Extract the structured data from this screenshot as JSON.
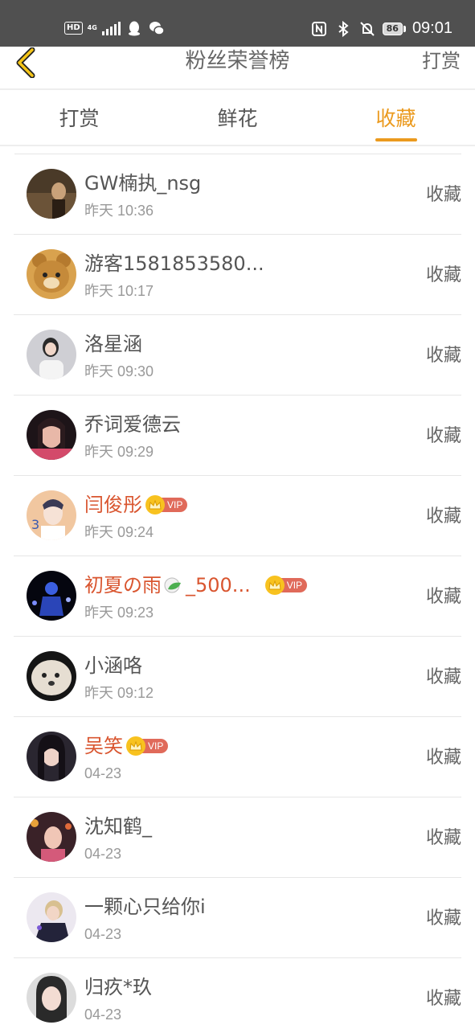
{
  "status_bar": {
    "hd": "HD",
    "network": "4G",
    "time": "09:01",
    "battery": "86"
  },
  "header": {
    "title": "粉丝荣誉榜",
    "action_label": "打赏"
  },
  "tabs": [
    {
      "label": "打赏",
      "active": false
    },
    {
      "label": "鲜花",
      "active": false
    },
    {
      "label": "收藏",
      "active": true
    }
  ],
  "colors": {
    "accent": "#eb9a1e",
    "vip_name": "#d9552f",
    "vip_tag": "#e06a5a",
    "crown": "#f8c21f"
  },
  "rows": [
    {
      "name": "GW楠执_nsg",
      "time": "昨天 10:36",
      "action": "收藏",
      "vip": false
    },
    {
      "name": "游客1581853580...",
      "time": "昨天 10:17",
      "action": "收藏",
      "vip": false
    },
    {
      "name": "洛星涵",
      "time": "昨天 09:30",
      "action": "收藏",
      "vip": false
    },
    {
      "name": "乔词爱德云",
      "time": "昨天 09:29",
      "action": "收藏",
      "vip": false
    },
    {
      "name": "闫俊彤",
      "time": "昨天 09:24",
      "action": "收藏",
      "vip": true,
      "vip_label": "VIP"
    },
    {
      "name_a": "初夏の雨",
      "name_b": "_500...",
      "time": "昨天 09:23",
      "action": "收藏",
      "vip": true,
      "vip_label": "VIP"
    },
    {
      "name": "小涵咯",
      "time": "昨天 09:12",
      "action": "收藏",
      "vip": false
    },
    {
      "name": "吴笑",
      "time": "04-23",
      "action": "收藏",
      "vip": true,
      "vip_label": "VIP"
    },
    {
      "name": "沈知鹤_",
      "time": "04-23",
      "action": "收藏",
      "vip": false
    },
    {
      "name": "一颗心只给你i",
      "time": "04-23",
      "action": "收藏",
      "vip": false
    },
    {
      "name": "归疚*玖",
      "time": "04-23",
      "action": "收藏",
      "vip": false
    }
  ]
}
